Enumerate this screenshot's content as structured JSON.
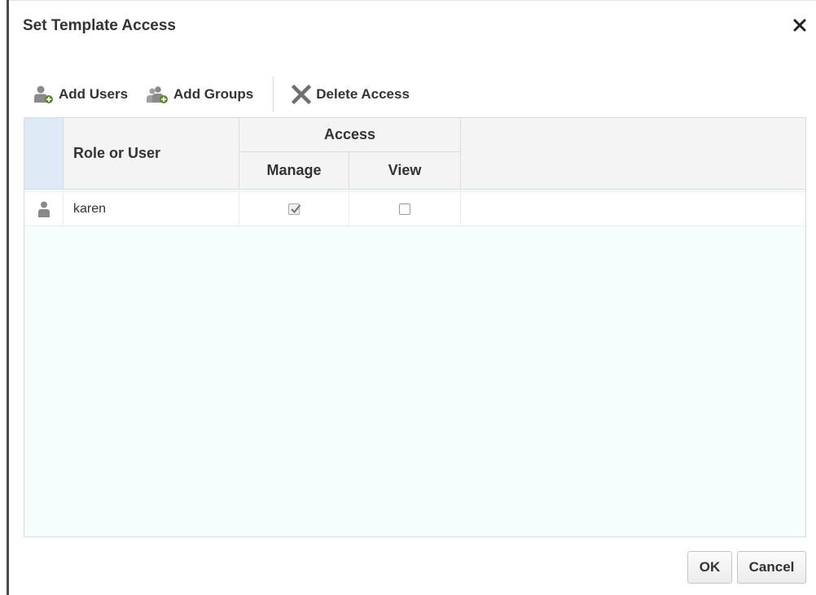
{
  "dialog": {
    "title": "Set Template Access",
    "close_symbol": "✕"
  },
  "toolbar": {
    "add_users_label": "Add Users",
    "add_groups_label": "Add Groups",
    "delete_access_label": "Delete Access"
  },
  "table": {
    "headers": {
      "role_or_user": "Role or User",
      "access": "Access",
      "manage": "Manage",
      "view": "View"
    },
    "rows": [
      {
        "name": "karen",
        "type_icon": "user-icon",
        "manage": true,
        "view": false
      }
    ]
  },
  "footer": {
    "ok_label": "OK",
    "cancel_label": "Cancel"
  },
  "colors": {
    "header_bg": "#f4f4f4",
    "selector_bg": "#deebf6",
    "grid_body_bg": "#f5fdfd",
    "border": "#d6dde2"
  }
}
